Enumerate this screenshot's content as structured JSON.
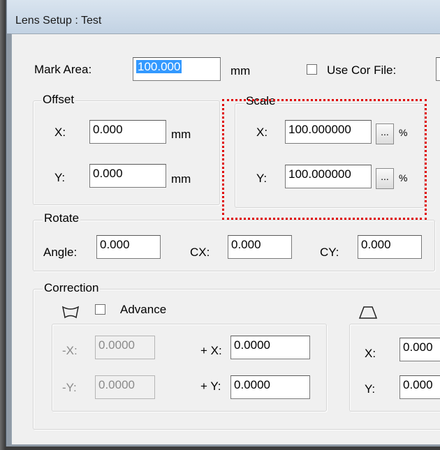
{
  "window": {
    "title": "Lens Setup : Test"
  },
  "mark_area": {
    "label": "Mark Area:",
    "value": "100.000",
    "unit": "mm",
    "use_cor_file_label": "Use Cor File:"
  },
  "offset": {
    "title": "Offset",
    "x_label": "X:",
    "x_value": "0.000",
    "y_label": "Y:",
    "y_value": "0.000",
    "unit": "mm"
  },
  "scale": {
    "title": "Scale",
    "x_label": "X:",
    "x_value": "100.000000",
    "y_label": "Y:",
    "y_value": "100.000000",
    "browse_label": "...",
    "unit": "%"
  },
  "rotate": {
    "title": "Rotate",
    "angle_label": "Angle:",
    "angle_value": "0.000",
    "cx_label": "CX:",
    "cx_value": "0.000",
    "cy_label": "CY:",
    "cy_value": "0.000"
  },
  "correction": {
    "title": "Correction",
    "advance_label": "Advance",
    "minus_x_label": "-X:",
    "minus_x_value": "0.0000",
    "minus_y_label": "-Y:",
    "minus_y_value": "0.0000",
    "plus_x_label": "+ X:",
    "plus_x_value": "0.0000",
    "plus_y_label": "+ Y:",
    "plus_y_value": "0.0000",
    "trap_x_label": "X:",
    "trap_x_value": "0.000",
    "trap_y_label": "Y:",
    "trap_y_value": "0.000"
  }
}
